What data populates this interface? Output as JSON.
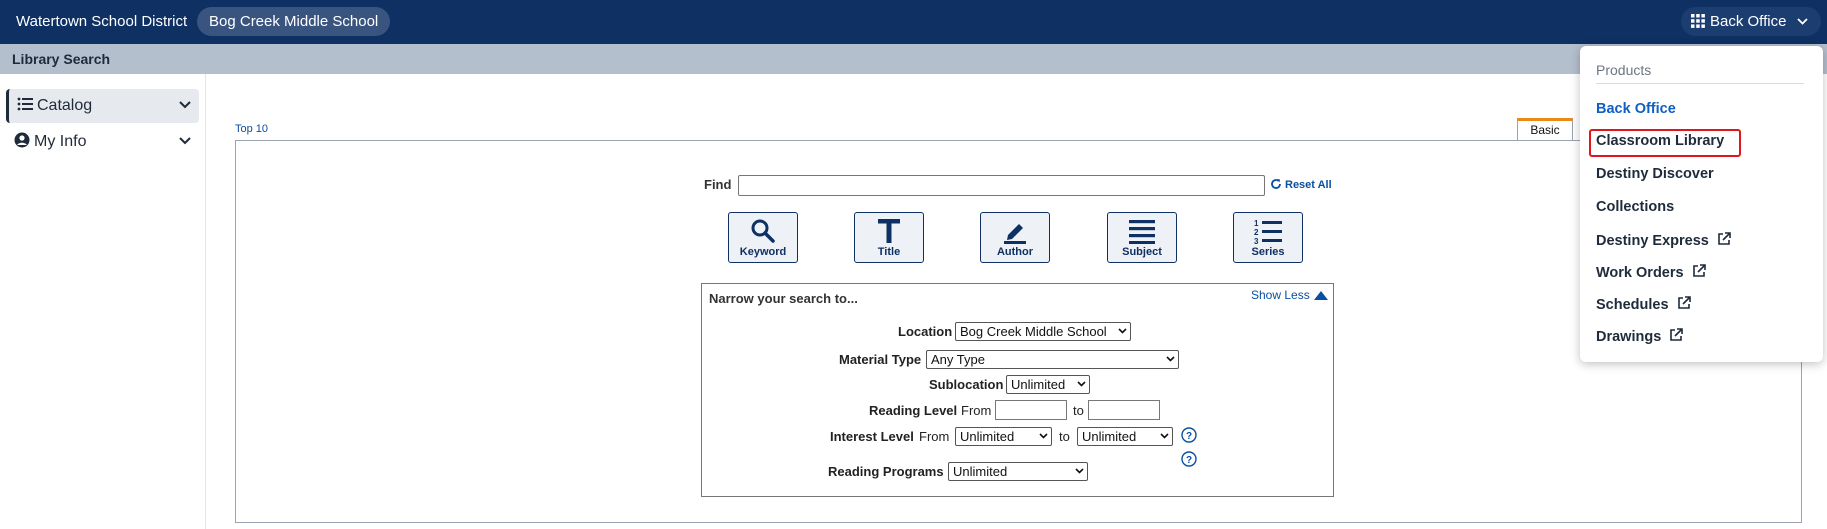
{
  "header": {
    "district": "Watertown School District",
    "school": "Bog Creek Middle School",
    "product_button": "Back Office"
  },
  "subbar": {
    "title": "Library Search"
  },
  "sidebar": {
    "items": [
      {
        "label": "Catalog",
        "icon": "list-icon",
        "active": true
      },
      {
        "label": "My Info",
        "icon": "user-circle-icon",
        "active": false
      }
    ]
  },
  "main": {
    "top10_link": "Top 10",
    "tab_basic": "Basic",
    "find_label": "Find",
    "find_value": "",
    "reset_all": "Reset All",
    "search_buttons": [
      {
        "label": "Keyword",
        "icon": "magnifier-icon"
      },
      {
        "label": "Title",
        "icon": "title-t-icon"
      },
      {
        "label": "Author",
        "icon": "pen-icon"
      },
      {
        "label": "Subject",
        "icon": "lines-icon"
      },
      {
        "label": "Series",
        "icon": "numbered-list-icon"
      }
    ],
    "narrow": {
      "title": "Narrow your search to...",
      "show_less": "Show Less",
      "location_label": "Location",
      "location_value": "Bog Creek Middle School",
      "material_label": "Material Type",
      "material_value": "Any Type",
      "sublocation_label": "Sublocation",
      "sublocation_value": "Unlimited",
      "reading_label": "Reading Level",
      "reading_from": "From",
      "reading_to": "to",
      "interest_label": "Interest Level",
      "interest_from": "From",
      "interest_from_value": "Unlimited",
      "interest_to": "to",
      "interest_to_value": "Unlimited",
      "programs_label": "Reading Programs",
      "programs_value": "Unlimited"
    }
  },
  "menu": {
    "heading": "Products",
    "items": [
      {
        "label": "Back Office",
        "selected": true,
        "external": false
      },
      {
        "label": "Classroom Library",
        "selected": false,
        "external": false,
        "highlighted": true
      },
      {
        "label": "Destiny Discover",
        "selected": false,
        "external": false
      },
      {
        "label": "Collections",
        "selected": false,
        "external": false
      },
      {
        "label": "Destiny Express",
        "selected": false,
        "external": true
      },
      {
        "label": "Work Orders",
        "selected": false,
        "external": true
      },
      {
        "label": "Schedules",
        "selected": false,
        "external": true
      },
      {
        "label": "Drawings",
        "selected": false,
        "external": true
      }
    ]
  },
  "colors": {
    "header_bg": "#0f3063",
    "subbar_bg": "#b4bfcd",
    "link": "#0a4fa0",
    "menu_selected": "#0f5fc4",
    "highlight": "#e0161f",
    "tab_accent": "#e8891a"
  }
}
